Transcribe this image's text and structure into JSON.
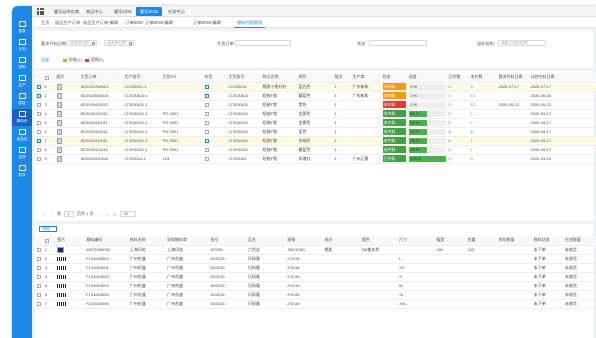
{
  "sidebar": {
    "items": [
      {
        "label": "报表",
        "icon": "chart-icon"
      },
      {
        "label": "计划",
        "icon": "calendar-icon"
      },
      {
        "label": "采购",
        "icon": "cart-icon"
      },
      {
        "label": "生产",
        "icon": "factory-icon"
      },
      {
        "label": "质检",
        "icon": "check-icon"
      },
      {
        "label": "物料仓",
        "icon": "box-icon"
      },
      {
        "label": "成品仓",
        "icon": "warehouse-icon"
      },
      {
        "label": "出货",
        "icon": "truck-icon"
      },
      {
        "label": "财务",
        "icon": "money-icon"
      }
    ],
    "active_index": 5
  },
  "modules": [
    "健乐云供应商",
    "商品中心",
    "健乐OOS",
    "健乐SCM",
    "任务中心"
  ],
  "page_tabs": [
    "主页",
    "成品生产订单",
    "成品生产订单-编辑",
    "订单BOM",
    "订单BOM-编辑",
    "订单BOM-编辑",
    "物料齐套管理"
  ],
  "filters": {
    "date_label": "要求齐料日期",
    "date_from_placeholder": "请选择日期",
    "date_sep": "-",
    "date_to_placeholder": "请选择日期",
    "order_label": "大货订单",
    "status_label": "状态",
    "operator_label": "组织机构",
    "operator_placeholder": "请输入组织机构"
  },
  "legend": [
    {
      "label": "全部",
      "color": "#1e88e5"
    },
    {
      "label": "即临(1)",
      "color": "#f39c12"
    },
    {
      "label": "超期(1)",
      "color": "#e53935"
    }
  ],
  "table1": {
    "headers": [
      "",
      "",
      "图片",
      "大货订单",
      "生产批号",
      "大货PO",
      "补货",
      "大货款号",
      "款式名称",
      "颜色",
      "批次",
      "生产商",
      "状态",
      "进度",
      "已齐数",
      "未齐数",
      "要求齐料日期",
      "计划齐料日期"
    ],
    "rows": [
      {
        "no": "1",
        "order": "SD2020708021",
        "batch": "LC202021-1",
        "po": "",
        "checked": true,
        "style_no": "LC202021",
        "style_name": "棉质小兔衬衫",
        "color": "蓝白色",
        "lot": "1",
        "maker": "广东新和",
        "status": "未齐料",
        "status_color": "#f39c12",
        "progress": 0,
        "ready": "0",
        "not_ready": "9",
        "req_date": "2020-07-17",
        "plan_date": "2020-07-17",
        "hl": true
      },
      {
        "no": "2",
        "order": "SD2020616015",
        "batch": "LT2020615-1",
        "po": "",
        "checked": true,
        "style_no": "LT2020615",
        "style_name": "短袖T恤",
        "color": "藏蓝色",
        "lot": "1",
        "maker": "广东新和",
        "status": "未齐料",
        "status_color": "#f39c12",
        "progress": 0,
        "ready": "0",
        "not_ready": "10",
        "req_date": "",
        "plan_date": "2020-06-16",
        "hl": false
      },
      {
        "no": "3",
        "order": "SD2020411012",
        "batch": "LT2020411-1",
        "po": "",
        "checked": false,
        "style_no": "LT2020411",
        "style_name": "短袖T恤",
        "color": "黑色",
        "lot": "1",
        "maker": "",
        "status": "未齐料",
        "status_color": "#e53935",
        "progress": 0,
        "ready": "0",
        "not_ready": "12",
        "req_date": "2020-05-12",
        "plan_date": "2020-05-12",
        "hl": false
      },
      {
        "no": "4",
        "order": "SD2020411011",
        "batch": "LT2020411-1",
        "po": "PO 0001",
        "checked": false,
        "style_no": "LT2020411",
        "style_name": "短袖T恤",
        "color": "金黄色",
        "lot": "1",
        "maker": "",
        "status": "未齐料",
        "status_color": "#43a047",
        "progress": 50,
        "ready": "6",
        "not_ready": "7",
        "req_date": "",
        "plan_date": "2020-04-17",
        "hl": false
      },
      {
        "no": "5",
        "order": "SD2020411011",
        "batch": "LT2020411-1",
        "po": "PO 0001",
        "checked": false,
        "style_no": "LT2020411",
        "style_name": "短袖T恤",
        "color": "金黄色",
        "lot": "1",
        "maker": "",
        "status": "未齐料",
        "status_color": "#43a047",
        "progress": 50,
        "ready": "6",
        "not_ready": "7",
        "req_date": "",
        "plan_date": "2020-04-17",
        "hl": false
      },
      {
        "no": "6",
        "order": "SD2020411011",
        "batch": "LT2020411-1",
        "po": "PO 0001",
        "checked": false,
        "style_no": "LT2020411",
        "style_name": "短袖T恤",
        "color": "蓝色",
        "lot": "1",
        "maker": "",
        "status": "未齐料",
        "status_color": "#43a047",
        "progress": 50,
        "ready": "6",
        "not_ready": "6",
        "req_date": "",
        "plan_date": "2020-04-17",
        "hl": false
      },
      {
        "no": "7",
        "order": "SD2020411011",
        "batch": "LT2020411-1",
        "po": "PO 0001",
        "checked": true,
        "style_no": "LT2020411",
        "style_name": "短袖T恤",
        "color": "灰绿色",
        "lot": "1",
        "maker": "",
        "status": "未齐料",
        "status_color": "#43a047",
        "progress": 50,
        "ready": "6",
        "not_ready": "7",
        "req_date": "",
        "plan_date": "2020-04-17",
        "hl": true
      },
      {
        "no": "8",
        "order": "SD2020411011",
        "batch": "LT2020411-1",
        "po": "PO 0001",
        "checked": false,
        "style_no": "LT2020411",
        "style_name": "短袖T恤",
        "color": "藏蓝色",
        "lot": "1",
        "maker": "",
        "status": "未齐料",
        "status_color": "#43a047",
        "progress": 50,
        "ready": "6",
        "not_ready": "7",
        "req_date": "",
        "plan_date": "2020-04-17",
        "hl": false
      },
      {
        "no": "9",
        "order": "SD2020410010",
        "batch": "LT202024-1",
        "po": "123",
        "checked": false,
        "style_no": "LT202024",
        "style_name": "短袖T恤",
        "color": "玫瑰红",
        "lot": "1",
        "maker": "广州汇雅",
        "status": "已齐料",
        "status_color": "#43a047",
        "progress": 100,
        "ready": "0",
        "not_ready": "0",
        "req_date": "",
        "plan_date": "2020-04-10",
        "hl": false
      }
    ]
  },
  "pager": {
    "page_label": "第",
    "page_value": "1",
    "page_total": "页共 1 页",
    "page_size": "25"
  },
  "detail_select": "齐料",
  "table2": {
    "headers": [
      "",
      "",
      "图片",
      "物料编码",
      "物料名称",
      "采购物料商",
      "批号",
      "品名",
      "规格",
      "成分",
      "颜色",
      "尺寸",
      "幅宽",
      "克重",
      "库存数量",
      "物料状态",
      "在途数量"
    ],
    "rows": [
      {
        "no": "1",
        "code": "MS71005003",
        "name": "上海印花",
        "supplier": "上海印花",
        "lot": "SC253",
        "item": "六色丝",
        "spec": "750*120D",
        "comp": "棉质",
        "color": "2M紫灰色",
        "size": "",
        "width": "150",
        "weight": "123",
        "stock": "",
        "state": "未下单",
        "transit": "未收货"
      },
      {
        "no": "2",
        "code": "F131004004",
        "name": "广州东盛",
        "supplier": "广州东盛",
        "lot": "D03215",
        "item": "尺码唛",
        "spec": "2*2CM",
        "comp": "",
        "color": "",
        "size": "L",
        "width": "",
        "weight": "",
        "stock": "",
        "state": "未下单",
        "transit": "未收货"
      },
      {
        "no": "3",
        "code": "F131004001",
        "name": "广州东盛",
        "supplier": "广州东盛",
        "lot": "D03215",
        "item": "尺码唛",
        "spec": "2*2CM",
        "comp": "",
        "color": "",
        "size": "XS",
        "width": "",
        "weight": "",
        "stock": "",
        "state": "未下单",
        "transit": "未收货"
      },
      {
        "no": "4",
        "code": "F131004002",
        "name": "广州东盛",
        "supplier": "广州东盛",
        "lot": "D03215",
        "item": "尺码唛",
        "spec": "2*2CM",
        "comp": "",
        "color": "",
        "size": "S",
        "width": "",
        "weight": "",
        "stock": "",
        "state": "未下单",
        "transit": "未收货"
      },
      {
        "no": "5",
        "code": "F131004003",
        "name": "广州东盛",
        "supplier": "广州东盛",
        "lot": "D03215",
        "item": "尺码唛",
        "spec": "2*2CM",
        "comp": "",
        "color": "",
        "size": "M",
        "width": "",
        "weight": "",
        "stock": "",
        "state": "未下单",
        "transit": "未收货"
      },
      {
        "no": "6",
        "code": "F131004005",
        "name": "广州东盛",
        "supplier": "广州东盛",
        "lot": "D03215",
        "item": "尺码唛",
        "spec": "2*2CM",
        "comp": "",
        "color": "",
        "size": "XL",
        "width": "",
        "weight": "",
        "stock": "",
        "state": "未下单",
        "transit": "未收货"
      },
      {
        "no": "7",
        "code": "F131004006",
        "name": "广州东盛",
        "supplier": "广州东盛",
        "lot": "D03215",
        "item": "尺码唛",
        "spec": "2*2CM",
        "comp": "",
        "color": "",
        "size": "XXL",
        "width": "",
        "weight": "",
        "stock": "",
        "state": "未下单",
        "transit": "未收货"
      }
    ]
  }
}
